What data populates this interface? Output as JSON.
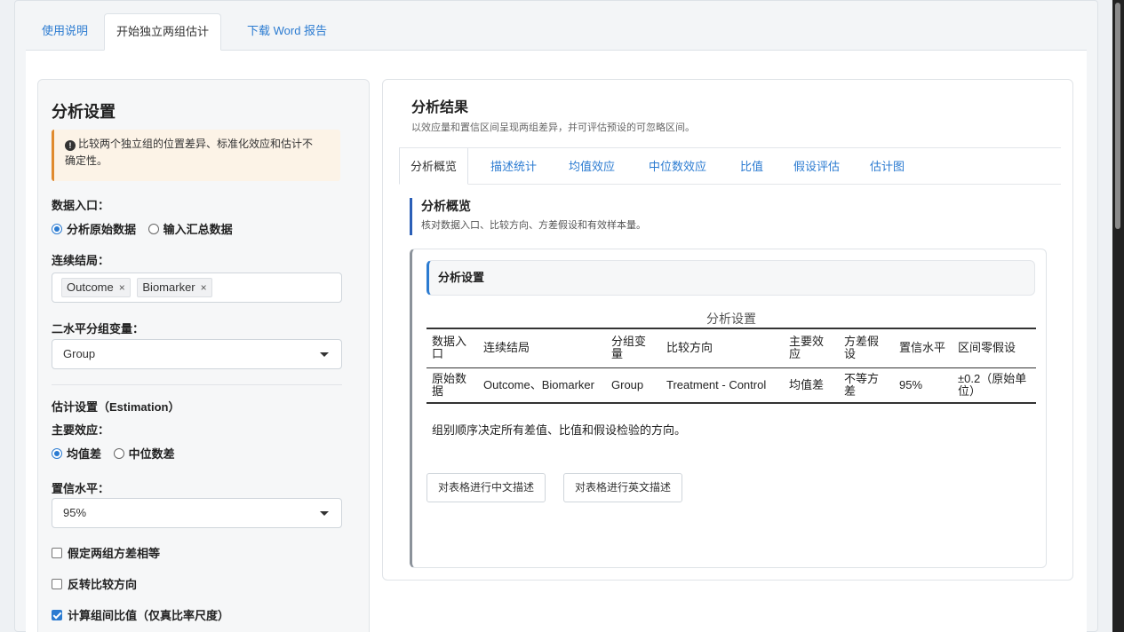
{
  "main_tabs": {
    "tab1": "使用说明",
    "tab2": "开始独立两组估计",
    "tab3": "下载 Word 报告"
  },
  "settings": {
    "title": "分析设置",
    "warning_icon": "info-icon",
    "warning_line1": "比较两个独立组的位置差异、标准化效应和估计不",
    "warning_line2": "确定性。",
    "data_entry_label": "数据入口：",
    "data_entry_opt1": "分析原始数据",
    "data_entry_opt2": "输入汇总数据",
    "outcome_label": "连续结局：",
    "outcome_chips": [
      "Outcome",
      "Biomarker"
    ],
    "chip_remove": "×",
    "group_label": "二水平分组变量：",
    "group_value": "Group",
    "estimation_label": "估计设置（Estimation）",
    "effect_label": "主要效应：",
    "effect_opt1": "均值差",
    "effect_opt2": "中位数差",
    "conf_label": "置信水平：",
    "conf_value": "95%",
    "cb_equal_var": "假定两组方差相等",
    "cb_reverse": "反转比较方向",
    "cb_ratio": "计算组间比值（仅真比率尺度）"
  },
  "results": {
    "title": "分析结果",
    "subtitle": "以效应量和置信区间呈现两组差异，并可评估预设的可忽略区间。",
    "tabs": [
      "分析概览",
      "描述统计",
      "均值效应",
      "中位数效应",
      "比值",
      "假设评估",
      "估计图"
    ],
    "section_title": "分析概览",
    "section_sub": "核对数据入口、比较方向、方差假设和有效样本量。",
    "card_title": "分析设置",
    "table_caption": "分析设置",
    "headers": [
      "数据入口",
      "连续结局",
      "分组变量",
      "比较方向",
      "主要效应",
      "方差假设",
      "置信水平",
      "区间零假设"
    ],
    "row": [
      "原始数据",
      "Outcome、Biomarker",
      "Group",
      "Treatment - Control",
      "均值差",
      "不等方差",
      "95%",
      "±0.2（原始单位）"
    ],
    "note": "组别顺序决定所有差值、比值和假设检验的方向。",
    "btn_cn": "对表格进行中文描述",
    "btn_en": "对表格进行英文描述"
  }
}
